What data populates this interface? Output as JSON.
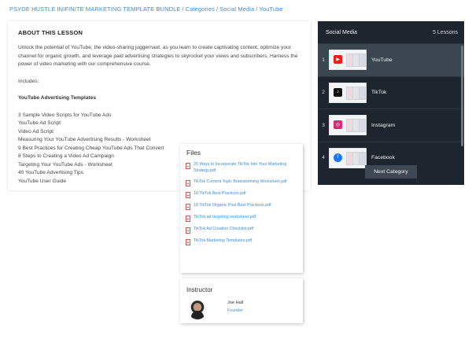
{
  "breadcrumb": {
    "items": [
      "PSYDE HUSTLE INIFINITE MARKETING TEMPLATE BUNDLE",
      "Categories",
      "Social Media",
      "YouTube"
    ],
    "separator": "/"
  },
  "about": {
    "heading": "ABOUT THIS LESSON",
    "description": "Unlock the potential of YouTube, the video-sharing juggernaut, as you learn to create captivating content, optimize your channel for organic growth, and leverage paid advertising strategies to skyrocket your views and subscribers. Harness the power of video marketing with our comprehensive course.",
    "includes_label": "Includes:",
    "list_title": "YouTube Advertising Templates",
    "items": [
      "3 Sample Video Scripts for YouTube Ads",
      "YouTube Ad Script",
      "Video Ad Script",
      "Measuring Your YouTube Advertising Results - Worksheet",
      "9 Best Practices for Creating Cheap YouTube Ads That Convert",
      "8 Steps to Creating a Video Ad Campaign",
      "Targeting Your YouTube Ads - Worksheet",
      "40 YouTube Advertising Tips",
      "YouTube User Guide"
    ]
  },
  "sidebar": {
    "title": "Social Media",
    "count": "5 Lessons",
    "lessons": [
      {
        "num": "1",
        "name": "YouTube",
        "icon": "youtube-icon",
        "color": "#e62117",
        "active": true
      },
      {
        "num": "2",
        "name": "TikTok",
        "icon": "tiktok-icon",
        "color": "#111111",
        "active": false
      },
      {
        "num": "3",
        "name": "Instagram",
        "icon": "instagram-icon",
        "color": "#d62976",
        "active": false
      },
      {
        "num": "4",
        "name": "Facebook",
        "icon": "facebook-icon",
        "color": "#1877f2",
        "active": false
      }
    ],
    "next_button": "Next Category"
  },
  "files": {
    "heading": "Files",
    "items": [
      "25 Ways to Incorporate TikTok Into Your Marketing Strategy.pdf",
      "TikTok Content Topic Brainstorming Worksheet.pdf",
      "18 TikTok Best Practices.pdf",
      "18 TikTok Organic Post Best Practices.pdf",
      "TikTok ad targeting worksheet.pdf",
      "TikTok Ad Creation Checklist.pdf",
      "TikTok Marketing Templates.pdf"
    ]
  },
  "instructor": {
    "heading": "Instructor",
    "name": "Joe Hall",
    "role": "Founder"
  },
  "colors": {
    "link": "#3a8fd6",
    "sidebar_bg": "#1d262e",
    "sidebar_active": "#3b4651"
  }
}
